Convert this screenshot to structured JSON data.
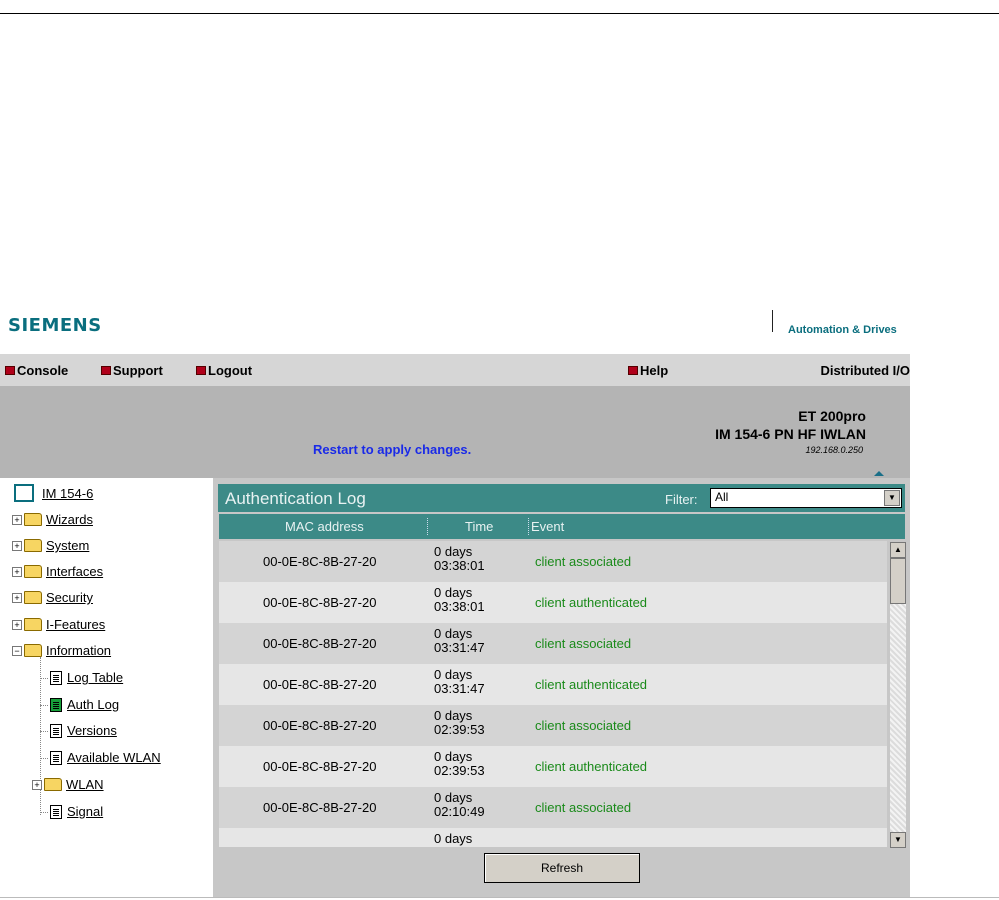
{
  "header": {
    "logo": "SIEMENS",
    "division": "Automation & Drives"
  },
  "navbar": {
    "items": [
      {
        "label": "Console"
      },
      {
        "label": "Support"
      },
      {
        "label": "Logout"
      }
    ],
    "help": "Help",
    "distributed": "Distributed I/O"
  },
  "device": {
    "restart_notice": "Restart to apply changes.",
    "title": "ET 200pro",
    "model": "IM 154-6 PN HF IWLAN",
    "ip": "192.168.0.250"
  },
  "tree": {
    "root": "IM 154-6",
    "folders": [
      "Wizards",
      "System",
      "Interfaces",
      "Security",
      "I-Features",
      "Information"
    ],
    "information_children": [
      "Log Table",
      "Auth Log",
      "Versions",
      "Available WLAN",
      "WLAN",
      "Signal"
    ]
  },
  "panel": {
    "title": "Authentication Log",
    "filter_label": "Filter:",
    "filter_value": "All",
    "columns": [
      "MAC address",
      "Time",
      "Event"
    ],
    "rows": [
      {
        "mac": "00-0E-8C-8B-27-20",
        "time1": "0 days",
        "time2": "03:38:01",
        "event": "client associated"
      },
      {
        "mac": "00-0E-8C-8B-27-20",
        "time1": "0 days",
        "time2": "03:38:01",
        "event": "client authenticated"
      },
      {
        "mac": "00-0E-8C-8B-27-20",
        "time1": "0 days",
        "time2": "03:31:47",
        "event": "client associated"
      },
      {
        "mac": "00-0E-8C-8B-27-20",
        "time1": "0 days",
        "time2": "03:31:47",
        "event": "client authenticated"
      },
      {
        "mac": "00-0E-8C-8B-27-20",
        "time1": "0 days",
        "time2": "02:39:53",
        "event": "client associated"
      },
      {
        "mac": "00-0E-8C-8B-27-20",
        "time1": "0 days",
        "time2": "02:39:53",
        "event": "client authenticated"
      },
      {
        "mac": "00-0E-8C-8B-27-20",
        "time1": "0 days",
        "time2": "02:10:49",
        "event": "client associated"
      },
      {
        "mac": "",
        "time1": "0 days",
        "time2": "",
        "event": ""
      }
    ],
    "refresh": "Refresh"
  },
  "colors": {
    "brand": "#0a6e7e",
    "teal_header": "#3c8a87",
    "event_green": "#1a8a1a",
    "notice_blue": "#1a2ae8",
    "bullet_red": "#b0001a"
  },
  "icons": {
    "nav_bullet": "red-square-icon",
    "tree_folder": "folder-icon",
    "tree_doc": "document-icon",
    "tree_root": "device-icon"
  }
}
